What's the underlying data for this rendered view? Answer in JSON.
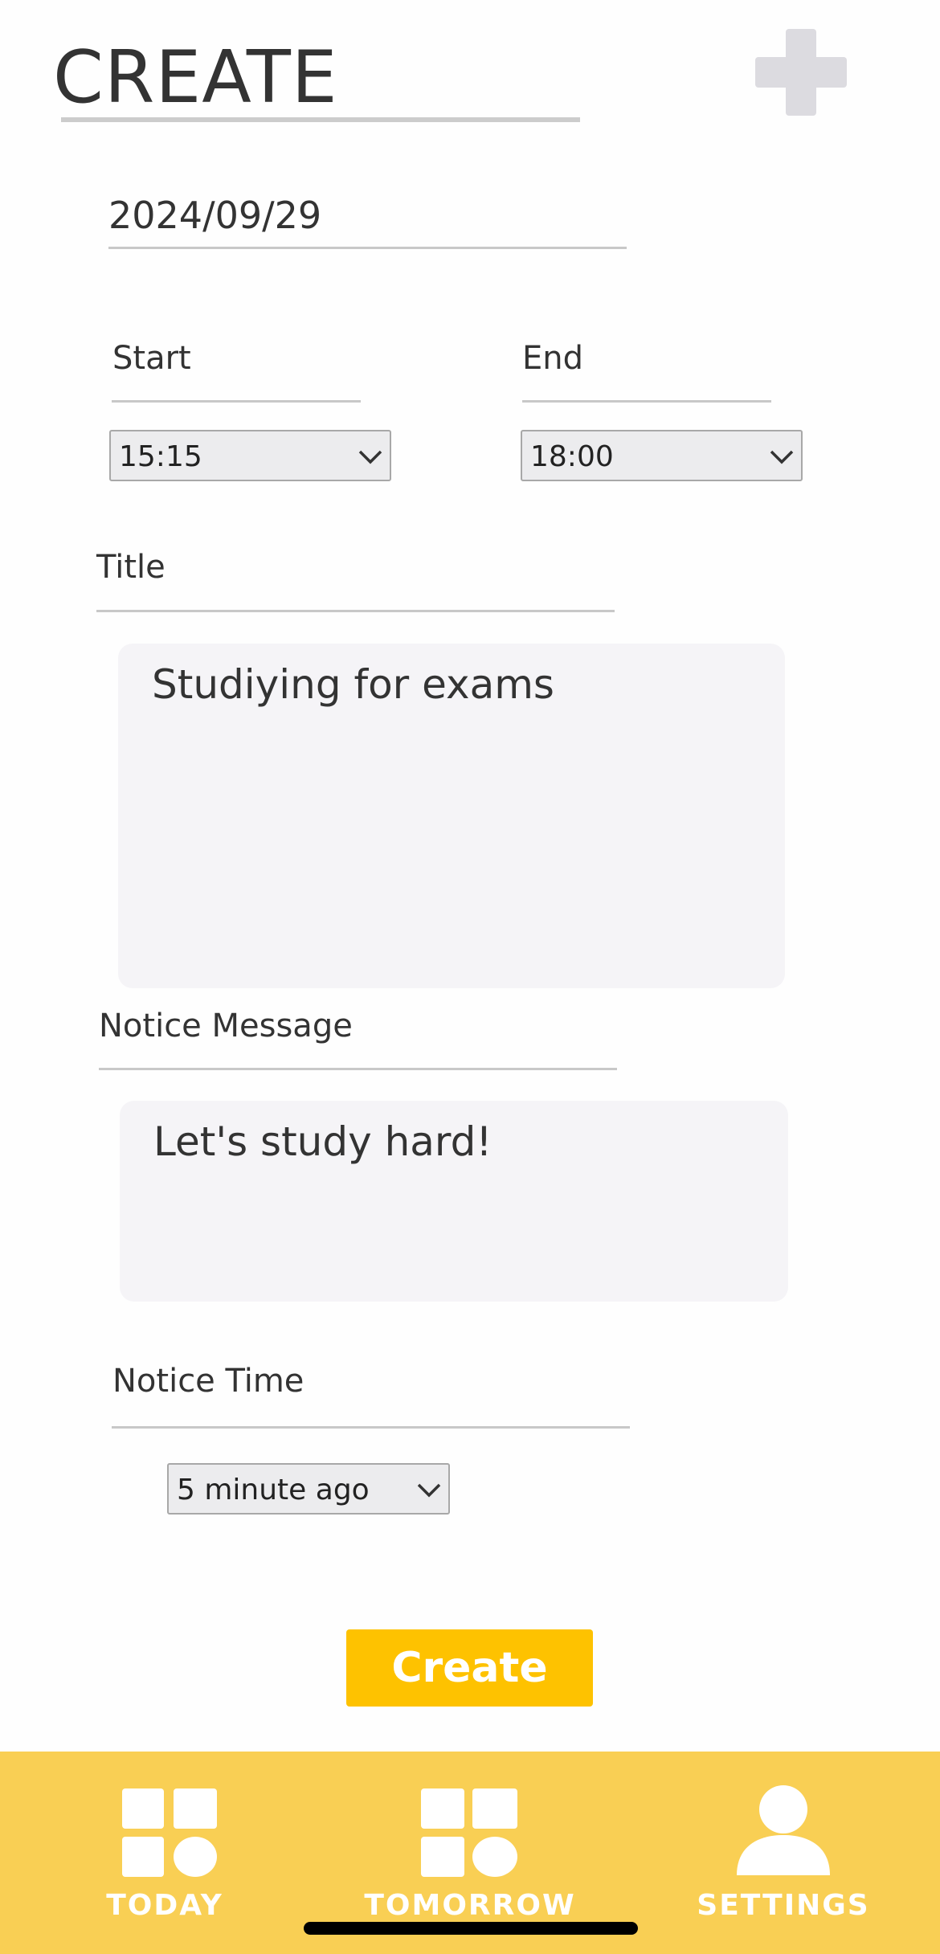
{
  "header": {
    "title": "CREATE",
    "add_icon": "plus-icon"
  },
  "form": {
    "date_value": "2024/09/29",
    "start_label": "Start",
    "start_value": "15:15",
    "end_label": "End",
    "end_value": "18:00",
    "title_label": "Title",
    "title_value": "Studiying for exams",
    "notice_message_label": "Notice Message",
    "notice_message_value": "Let's study hard!",
    "notice_time_label": "Notice Time",
    "notice_time_value": "5 minute ago",
    "create_label": "Create"
  },
  "tabbar": {
    "tabs": [
      {
        "label": "TODAY",
        "icon": "grid-icon"
      },
      {
        "label": "TOMORROW",
        "icon": "grid-icon"
      },
      {
        "label": "SETTINGS",
        "icon": "user-icon"
      }
    ]
  },
  "colors": {
    "accent": "#fec200",
    "tabbar": "#f9cf54",
    "text": "#333333",
    "field_bg": "#f5f4f7"
  }
}
